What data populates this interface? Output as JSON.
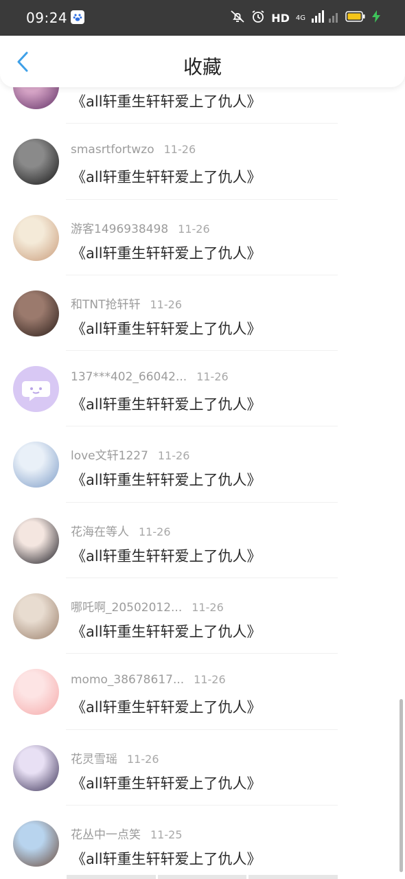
{
  "status_bar": {
    "time": "09:24",
    "hd": "HD",
    "net": "4G",
    "icons": [
      "baidu-app-icon",
      "mute-icon",
      "alarm-icon",
      "signal-icon",
      "battery-icon",
      "charging-icon"
    ]
  },
  "header": {
    "title": "收藏",
    "back_icon": "chevron-left-icon"
  },
  "colors": {
    "accent": "#3ea0e8",
    "status_bar_bg": "#3a3a3a",
    "battery": "#f5c518",
    "charging": "#3ec35a"
  },
  "items": [
    {
      "user": "",
      "date": "",
      "book": "《all轩重生轩轩爱上了仇人》",
      "avatar": [
        "#d9a7c9",
        "#5e2e63"
      ]
    },
    {
      "user": "smasrtfortwzo",
      "date": "11-26",
      "book": "《all轩重生轩轩爱上了仇人》",
      "avatar": [
        "#8a8a8a",
        "#151515"
      ]
    },
    {
      "user": "游客1496938498",
      "date": "11-26",
      "book": "《all轩重生轩轩爱上了仇人》",
      "avatar": [
        "#f4ead8",
        "#c99b7a"
      ]
    },
    {
      "user": "和TNT抢轩轩",
      "date": "11-26",
      "book": "《all轩重生轩轩爱上了仇人》",
      "avatar": [
        "#9b7a6d",
        "#2a1d19"
      ]
    },
    {
      "user": "137***402_66042...",
      "date": "11-26",
      "book": "《all轩重生轩轩爱上了仇人》",
      "avatar": [
        "#d8c8f4",
        "#d8c8f4"
      ]
    },
    {
      "user": "love文轩1227",
      "date": "11-26",
      "book": "《all轩重生轩轩爱上了仇人》",
      "avatar": [
        "#e9f0f8",
        "#7d9cc7"
      ]
    },
    {
      "user": "花海在等人",
      "date": "11-26",
      "book": "《all轩重生轩轩爱上了仇人》",
      "avatar": [
        "#f4e6e0",
        "#1a1a22"
      ]
    },
    {
      "user": "哪吒啊_20502012...",
      "date": "11-26",
      "book": "《all轩重生轩轩爱上了仇人》",
      "avatar": [
        "#e8dcd0",
        "#9a7f6b"
      ]
    },
    {
      "user": "momo_38678617...",
      "date": "11-26",
      "book": "《all轩重生轩轩爱上了仇人》",
      "avatar": [
        "#fde4e4",
        "#f5a9a9"
      ]
    },
    {
      "user": "花灵雪瑶",
      "date": "11-26",
      "book": "《all轩重生轩轩爱上了仇人》",
      "avatar": [
        "#e8e0f4",
        "#3a3156"
      ]
    },
    {
      "user": "花丛中一点笑",
      "date": "11-25",
      "book": "《all轩重生轩轩爱上了仇人》",
      "avatar": [
        "#b8d4ee",
        "#6b4c3d"
      ]
    }
  ]
}
